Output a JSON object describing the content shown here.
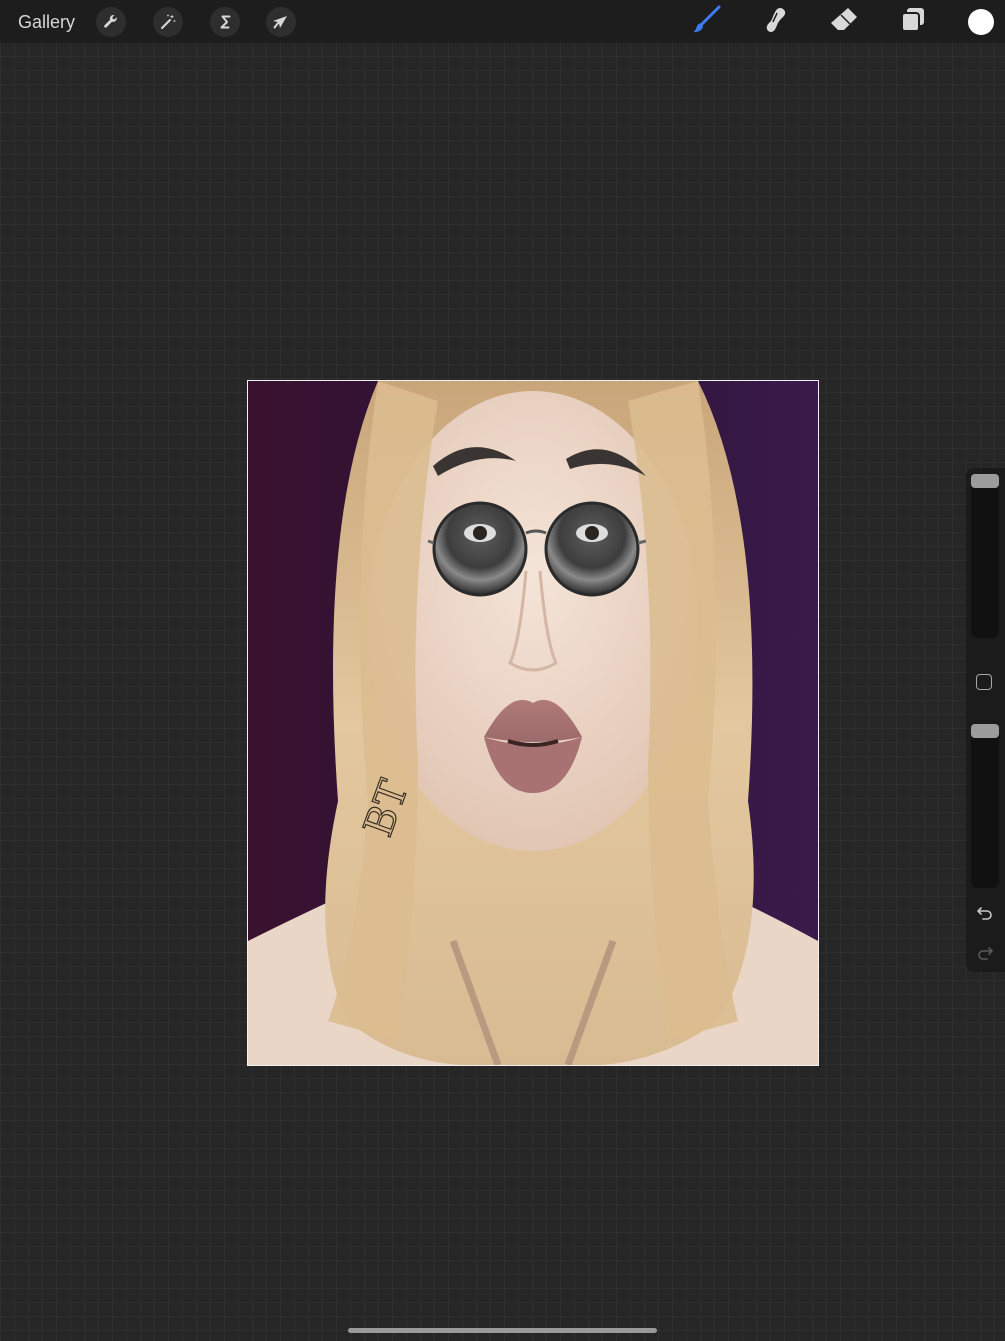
{
  "toolbar": {
    "gallery_label": "Gallery",
    "left_tools": [
      {
        "name": "actions",
        "icon": "wrench-icon"
      },
      {
        "name": "adjustments",
        "icon": "magic-wand-icon"
      },
      {
        "name": "selection",
        "icon": "selection-s-icon"
      },
      {
        "name": "transform",
        "icon": "arrow-cursor-icon"
      }
    ],
    "right_tools": [
      {
        "name": "brush",
        "icon": "brush-icon",
        "active": true
      },
      {
        "name": "smudge",
        "icon": "smudge-icon"
      },
      {
        "name": "eraser",
        "icon": "eraser-icon"
      },
      {
        "name": "layers",
        "icon": "layers-icon"
      }
    ],
    "current_color": "#ffffff",
    "active_tool_color": "#3d7bf6"
  },
  "canvas": {
    "signature_text": "BT"
  },
  "sidebar": {
    "brush_size_level": 1.0,
    "opacity_level": 1.0,
    "undo_icon": "undo-icon",
    "redo_icon": "redo-icon"
  }
}
